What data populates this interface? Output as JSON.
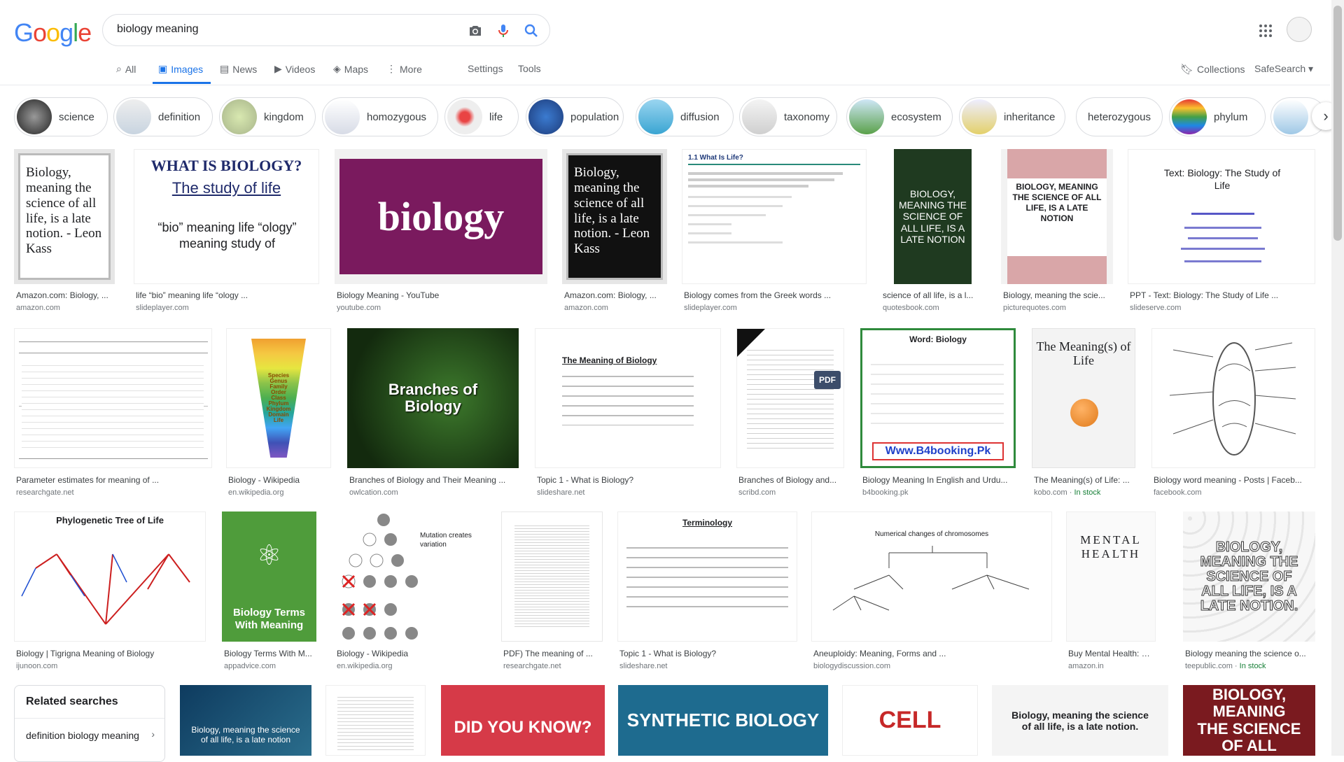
{
  "header": {
    "logo": "Google",
    "query": "biology meaning",
    "icons": [
      "camera-icon",
      "mic-icon",
      "search-icon",
      "apps-icon"
    ]
  },
  "tabs": [
    {
      "label": "All",
      "icon": "search-icon"
    },
    {
      "label": "Images",
      "icon": "image-icon"
    },
    {
      "label": "News",
      "icon": "news-icon"
    },
    {
      "label": "Videos",
      "icon": "video-icon"
    },
    {
      "label": "Maps",
      "icon": "map-icon"
    },
    {
      "label": "More",
      "icon": "more-icon"
    }
  ],
  "tools": {
    "settings": "Settings",
    "tools": "Tools",
    "collections": "Collections",
    "safesearch": "SafeSearch ▾"
  },
  "chips": [
    "science",
    "definition",
    "kingdom",
    "homozygous",
    "life",
    "population",
    "diffusion",
    "taxonomy",
    "ecosystem",
    "inheritance",
    "heterozygous",
    "phylum"
  ],
  "results": [
    {
      "title": "Amazon.com: Biology, ...",
      "source": "amazon.com",
      "img_text": "Biology, meaning the science of all life, is a late notion. - Leon Kass"
    },
    {
      "title": "life “bio” meaning life “ology ...",
      "source": "slideplayer.com",
      "img_text": "WHAT IS BIOLOGY?",
      "img_text2": "The study of life",
      "img_text3": "“bio” meaning life “ology” meaning study of"
    },
    {
      "title": "Biology Meaning - YouTube",
      "source": "youtube.com",
      "img_text": "biology"
    },
    {
      "title": "Amazon.com: Biology, ...",
      "source": "amazon.com",
      "img_text": "Biology, meaning the science of all life, is a late notion. - Leon Kass"
    },
    {
      "title": "Biology comes from the Greek words ...",
      "source": "slideplayer.com",
      "img_text": "1.1 What Is Life?"
    },
    {
      "title": "science of all life, is a l...",
      "source": "quotesbook.com",
      "img_text": "BIOLOGY, MEANING THE SCIENCE OF ALL LIFE, IS A LATE NOTION"
    },
    {
      "title": "Biology, meaning the scie...",
      "source": "picturequotes.com",
      "img_text": "BIOLOGY, MEANING THE SCIENCE OF ALL LIFE, IS A LATE NOTION"
    },
    {
      "title": "PPT - Text: Biology: The Study of Life ...",
      "source": "slideserve.com",
      "img_text": "Text: Biology: The Study of Life"
    },
    {
      "title": "Parameter estimates for meaning of ...",
      "source": "researchgate.net",
      "img_text": ""
    },
    {
      "title": "Biology - Wikipedia",
      "source": "en.wikipedia.org",
      "img_text": "Species Genus Family Order Class Phylum Kingdom Domain Life"
    },
    {
      "title": "Branches of Biology and Their Meaning ...",
      "source": "owlcation.com",
      "img_text": "Branches of Biology"
    },
    {
      "title": "Topic 1 - What is Biology?",
      "source": "slideshare.net",
      "img_text": "The Meaning of Biology"
    },
    {
      "title": "Branches of Biology and...",
      "source": "scribd.com",
      "img_text": "PDF"
    },
    {
      "title": "Biology Meaning In English and Urdu...",
      "source": "b4booking.pk",
      "img_text": "Word: Biology",
      "img_text2": "Www.B4booking.Pk"
    },
    {
      "title": "The Meaning(s) of Life: ...",
      "source": "kobo.com",
      "stock": "In stock",
      "img_text": "The Meaning(s) of Life"
    },
    {
      "title": "Biology word meaning - Posts | Faceb...",
      "source": "facebook.com",
      "img_text": ""
    },
    {
      "title": "Biology | Tigrigna Meaning of Biology",
      "source": "ijunoon.com",
      "img_text": "Phylogenetic Tree of Life"
    },
    {
      "title": "Biology Terms With M...",
      "source": "appadvice.com",
      "img_text": "Biology Terms With Meaning"
    },
    {
      "title": "Biology - Wikipedia",
      "source": "en.wikipedia.org",
      "img_text": "Mutation creates variation"
    },
    {
      "title": "PDF) The meaning of ...",
      "source": "researchgate.net",
      "img_text": ""
    },
    {
      "title": "Topic 1 - What is Biology?",
      "source": "slideshare.net",
      "img_text": "Terminology"
    },
    {
      "title": "Aneuploidy: Meaning, Forms and ...",
      "source": "biologydiscussion.com",
      "img_text": "Numerical changes of chromosomes"
    },
    {
      "title": "Buy Mental Health: Bi...",
      "source": "amazon.in",
      "img_text": "MENTAL HEALTH"
    },
    {
      "title": "Biology meaning the science o...",
      "source": "teepublic.com",
      "stock": "In stock",
      "img_text": "BIOLOGY, MEANING THE SCIENCE OF ALL LIFE, IS A LATE NOTION."
    }
  ],
  "bottom_row": [
    "Biology, meaning the science of all life, is a late notion",
    "",
    "DID YOU KNOW?",
    "SYNTHETIC BIOLOGY",
    "CELL",
    "Biology, meaning the science of all life, is a late notion.",
    "BIOLOGY, MEANING THE SCIENCE OF ALL"
  ],
  "related": {
    "title": "Related searches",
    "item": "definition biology meaning"
  }
}
